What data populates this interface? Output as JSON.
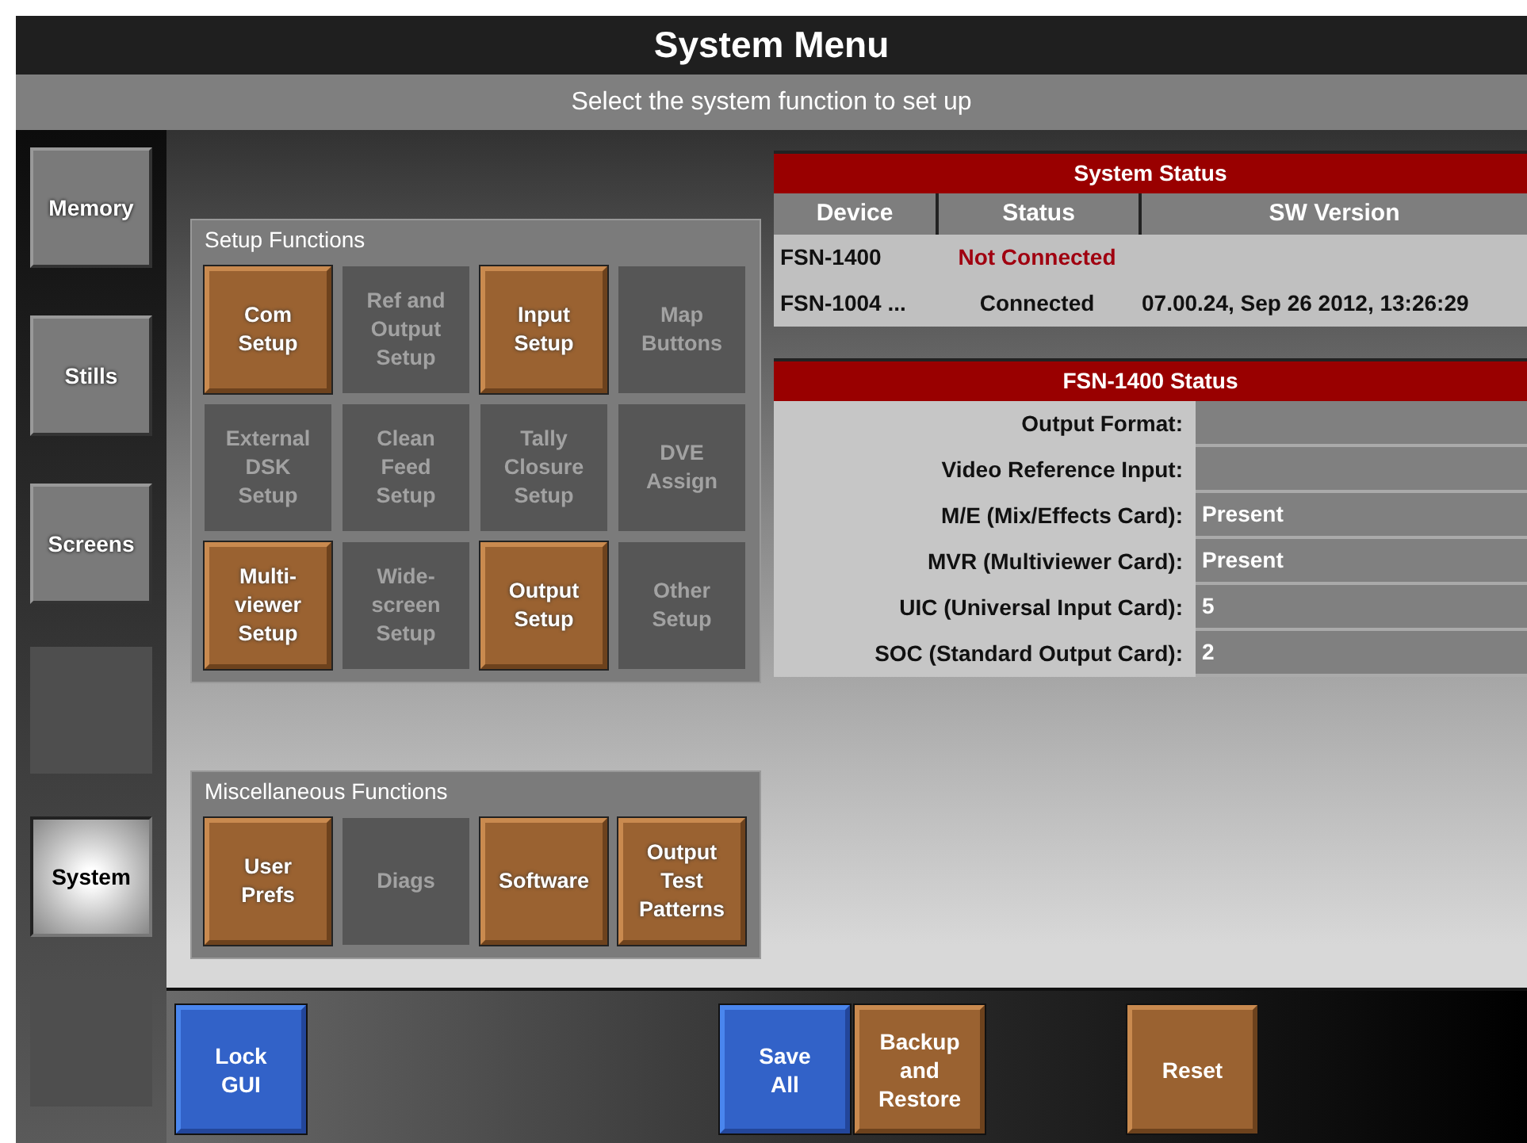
{
  "window": {
    "title": "System Menu",
    "subtitle": "Select the system function to set up"
  },
  "sidebar": {
    "items": [
      {
        "kind": "button",
        "label": "Memory",
        "selected": false
      },
      {
        "kind": "button",
        "label": "Stills",
        "selected": false
      },
      {
        "kind": "button",
        "label": "Screens",
        "selected": false
      },
      {
        "kind": "blank"
      },
      {
        "kind": "button",
        "label": "System",
        "selected": true
      },
      {
        "kind": "blank"
      }
    ]
  },
  "setup_functions": {
    "title": "Setup Functions",
    "buttons": [
      {
        "label": "Com Setup",
        "enabled": true
      },
      {
        "label": "Ref and Output Setup",
        "enabled": false
      },
      {
        "label": "Input Setup",
        "enabled": true
      },
      {
        "label": "Map Buttons",
        "enabled": false
      },
      {
        "label": "External DSK Setup",
        "enabled": false
      },
      {
        "label": "Clean Feed Setup",
        "enabled": false
      },
      {
        "label": "Tally Closure Setup",
        "enabled": false
      },
      {
        "label": "DVE Assign",
        "enabled": false
      },
      {
        "label": "Multi- viewer Setup",
        "enabled": true
      },
      {
        "label": "Wide- screen Setup",
        "enabled": false
      },
      {
        "label": "Output Setup",
        "enabled": true
      },
      {
        "label": "Other Setup",
        "enabled": false
      }
    ]
  },
  "misc_functions": {
    "title": "Miscellaneous Functions",
    "buttons": [
      {
        "label": "User Prefs",
        "enabled": true
      },
      {
        "label": "Diags",
        "enabled": false
      },
      {
        "label": "Software",
        "enabled": true
      },
      {
        "label": "Output Test Patterns",
        "enabled": true
      }
    ]
  },
  "system_status": {
    "title": "System Status",
    "columns": [
      "Device",
      "Status",
      "SW Version"
    ],
    "rows": [
      {
        "device": "FSN-1400",
        "status": "Not Connected",
        "connected": false
      },
      {
        "device": "FSN-1004 ...",
        "status": "Connected",
        "connected": true,
        "sw_version": "07.00.24, Sep 26 2012, 13:26:29"
      }
    ]
  },
  "device_status": {
    "title": "FSN-1400 Status",
    "fields": [
      {
        "label": "Output Format:"
      },
      {
        "label": "Video Reference Input:"
      },
      {
        "label": "M/E (Mix/Effects Card):",
        "value": "Present"
      },
      {
        "label": "MVR (Multiviewer Card):",
        "value": "Present"
      },
      {
        "label": "UIC (Universal Input Card):",
        "value": "5"
      },
      {
        "label": "SOC (Standard Output Card):",
        "value": "2"
      }
    ]
  },
  "bottom_bar": {
    "buttons": [
      {
        "label": "Lock GUI",
        "kind": "primary"
      },
      {
        "label": "Save All",
        "kind": "primary"
      },
      {
        "label": "Backup and Restore",
        "kind": "secondary"
      },
      {
        "label": "Reset",
        "kind": "secondary"
      }
    ]
  }
}
